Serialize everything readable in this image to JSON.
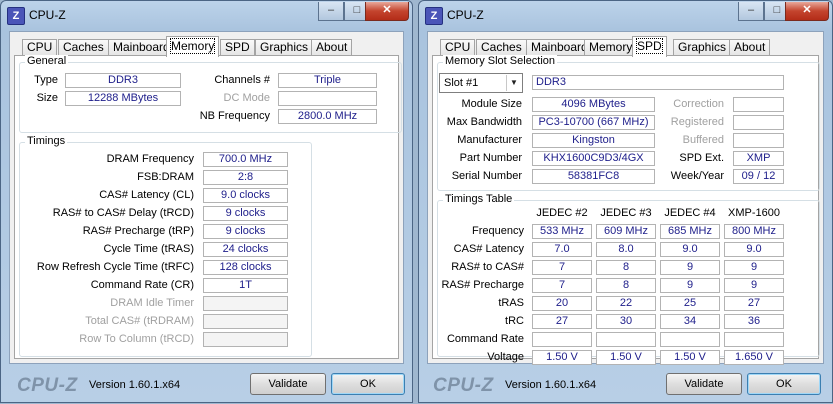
{
  "left": {
    "title": "CPU-Z",
    "window_controls": {
      "minimize": "–",
      "maximize": "□",
      "close": "✕"
    },
    "tabs": [
      "CPU",
      "Caches",
      "Mainboard",
      "Memory",
      "SPD",
      "Graphics",
      "About"
    ],
    "active_tab": "Memory",
    "general": {
      "label": "General",
      "type_label": "Type",
      "type_value": "DDR3",
      "size_label": "Size",
      "size_value": "12288 MBytes",
      "channels_label": "Channels #",
      "channels_value": "Triple",
      "dcmode_label": "DC Mode",
      "dcmode_value": "",
      "nbfreq_label": "NB Frequency",
      "nbfreq_value": "2800.0 MHz"
    },
    "timings": {
      "label": "Timings",
      "rows": [
        {
          "label": "DRAM Frequency",
          "value": "700.0 MHz"
        },
        {
          "label": "FSB:DRAM",
          "value": "2:8"
        },
        {
          "label": "CAS# Latency (CL)",
          "value": "9.0 clocks"
        },
        {
          "label": "RAS# to CAS# Delay (tRCD)",
          "value": "9 clocks"
        },
        {
          "label": "RAS# Precharge (tRP)",
          "value": "9 clocks"
        },
        {
          "label": "Cycle Time (tRAS)",
          "value": "24 clocks"
        },
        {
          "label": "Row Refresh Cycle Time (tRFC)",
          "value": "128 clocks"
        },
        {
          "label": "Command Rate (CR)",
          "value": "1T"
        },
        {
          "label": "DRAM Idle Timer",
          "value": ""
        },
        {
          "label": "Total CAS# (tRDRAM)",
          "value": ""
        },
        {
          "label": "Row To Column (tRCD)",
          "value": ""
        }
      ]
    },
    "footer": {
      "logo": "CPU-Z",
      "version": "Version 1.60.1.x64",
      "validate": "Validate",
      "ok": "OK"
    }
  },
  "right": {
    "title": "CPU-Z",
    "window_controls": {
      "minimize": "–",
      "maximize": "□",
      "close": "✕"
    },
    "tabs": [
      "CPU",
      "Caches",
      "Mainboard",
      "Memory",
      "SPD",
      "Graphics",
      "About"
    ],
    "active_tab": "SPD",
    "slot": {
      "label": "Memory Slot Selection",
      "selected": "Slot #1",
      "type_value": "DDR3",
      "module_size_label": "Module Size",
      "module_size_value": "4096 MBytes",
      "max_bw_label": "Max Bandwidth",
      "max_bw_value": "PC3-10700 (667 MHz)",
      "manufacturer_label": "Manufacturer",
      "manufacturer_value": "Kingston",
      "part_label": "Part Number",
      "part_value": "KHX1600C9D3/4GX",
      "serial_label": "Serial Number",
      "serial_value": "58381FC8",
      "correction_label": "Correction",
      "correction_value": "",
      "registered_label": "Registered",
      "registered_value": "",
      "buffered_label": "Buffered",
      "buffered_value": "",
      "spdext_label": "SPD Ext.",
      "spdext_value": "XMP",
      "weekyear_label": "Week/Year",
      "weekyear_value": "09 / 12"
    },
    "timings_table": {
      "label": "Timings Table",
      "columns": [
        "JEDEC #2",
        "JEDEC #3",
        "JEDEC #4",
        "XMP-1600"
      ],
      "rows": [
        {
          "label": "Frequency",
          "values": [
            "533 MHz",
            "609 MHz",
            "685 MHz",
            "800 MHz"
          ]
        },
        {
          "label": "CAS# Latency",
          "values": [
            "7.0",
            "8.0",
            "9.0",
            "9.0"
          ]
        },
        {
          "label": "RAS# to CAS#",
          "values": [
            "7",
            "8",
            "9",
            "9"
          ]
        },
        {
          "label": "RAS# Precharge",
          "values": [
            "7",
            "8",
            "9",
            "9"
          ]
        },
        {
          "label": "tRAS",
          "values": [
            "20",
            "22",
            "25",
            "27"
          ]
        },
        {
          "label": "tRC",
          "values": [
            "27",
            "30",
            "34",
            "36"
          ]
        },
        {
          "label": "Command Rate",
          "values": [
            "",
            "",
            "",
            ""
          ]
        },
        {
          "label": "Voltage",
          "values": [
            "1.50 V",
            "1.50 V",
            "1.50 V",
            "1.650 V"
          ]
        }
      ]
    },
    "footer": {
      "logo": "CPU-Z",
      "version": "Version 1.60.1.x64",
      "validate": "Validate",
      "ok": "OK"
    }
  }
}
